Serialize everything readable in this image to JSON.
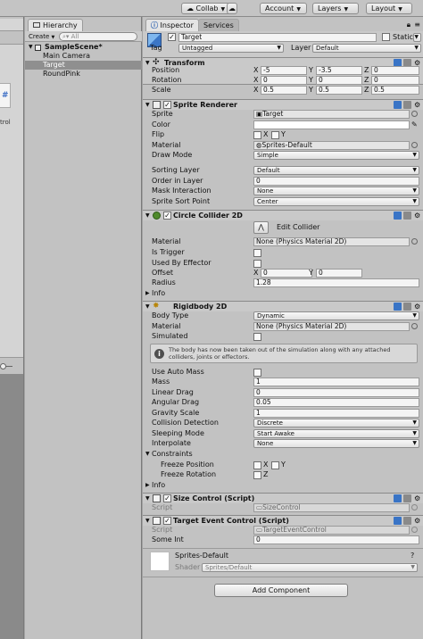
{
  "toolbar": {
    "collab": "Collab",
    "account": "Account",
    "layers": "Layers",
    "layout": "Layout"
  },
  "left_panel": {
    "script_glyph": "#",
    "label": "trol"
  },
  "hierarchy": {
    "tab": "Hierarchy",
    "create": "Create",
    "search_placeholder": "All",
    "scene": "SampleScene*",
    "items": [
      "Main Camera",
      "Target",
      "RoundPink"
    ],
    "selected_index": 1
  },
  "inspector": {
    "tab": "Inspector",
    "services_tab": "Services",
    "object": {
      "active": true,
      "name": "Target",
      "static_label": "Static",
      "static": false,
      "tag_label": "Tag",
      "tag": "Untagged",
      "layer_label": "Layer",
      "layer": "Default"
    },
    "transform": {
      "title": "Transform",
      "rows": [
        {
          "label": "Position",
          "x": "-5",
          "y": "-3.5",
          "z": "0"
        },
        {
          "label": "Rotation",
          "x": "0",
          "y": "0",
          "z": "0"
        },
        {
          "label": "Scale",
          "x": "0.5",
          "y": "0.5",
          "z": "0.5"
        }
      ],
      "axis": [
        "X",
        "Y",
        "Z"
      ]
    },
    "sprite_renderer": {
      "title": "Sprite Renderer",
      "sprite_label": "Sprite",
      "sprite": "Target",
      "color_label": "Color",
      "flip_label": "Flip",
      "flip_x": "X",
      "flip_y": "Y",
      "material_label": "Material",
      "material": "Sprites-Default",
      "draw_mode_label": "Draw Mode",
      "draw_mode": "Simple",
      "sorting_layer_label": "Sorting Layer",
      "sorting_layer": "Default",
      "order_label": "Order in Layer",
      "order": "0",
      "mask_label": "Mask Interaction",
      "mask": "None",
      "sort_point_label": "Sprite Sort Point",
      "sort_point": "Center"
    },
    "circle_collider": {
      "title": "Circle Collider 2D",
      "edit_label": "Edit Collider",
      "material_label": "Material",
      "material": "None (Physics Material 2D)",
      "trigger_label": "Is Trigger",
      "effector_label": "Used By Effector",
      "offset_label": "Offset",
      "offset_x": "0",
      "offset_y": "0",
      "radius_label": "Radius",
      "radius": "1.28",
      "info_label": "Info"
    },
    "rigidbody": {
      "title": "Rigidbody 2D",
      "body_type_label": "Body Type",
      "body_type": "Dynamic",
      "material_label": "Material",
      "material": "None (Physics Material 2D)",
      "simulated_label": "Simulated",
      "help": "The body has now been taken out of the simulation along with any attached colliders, joints or effectors.",
      "auto_mass_label": "Use Auto Mass",
      "mass_label": "Mass",
      "mass": "1",
      "linear_drag_label": "Linear Drag",
      "linear_drag": "0",
      "angular_drag_label": "Angular Drag",
      "angular_drag": "0.05",
      "gravity_label": "Gravity Scale",
      "gravity": "1",
      "collision_label": "Collision Detection",
      "collision": "Discrete",
      "sleeping_label": "Sleeping Mode",
      "sleeping": "Start Awake",
      "interpolate_label": "Interpolate",
      "interpolate": "None",
      "constraints_label": "Constraints",
      "freeze_pos_label": "Freeze Position",
      "freeze_pos_x": "X",
      "freeze_pos_y": "Y",
      "freeze_rot_label": "Freeze Rotation",
      "freeze_rot_z": "Z",
      "info_label": "Info"
    },
    "size_control": {
      "title": "Size Control (Script)",
      "script_label": "Script",
      "script": "SizeControl"
    },
    "target_event": {
      "title": "Target Event Control (Script)",
      "script_label": "Script",
      "script": "TargetEventControl",
      "some_int_label": "Some Int",
      "some_int": "0"
    },
    "material_preview": {
      "name": "Sprites-Default",
      "shader_label": "Shader",
      "shader": "Sprites/Default"
    },
    "add_component": "Add Component"
  }
}
